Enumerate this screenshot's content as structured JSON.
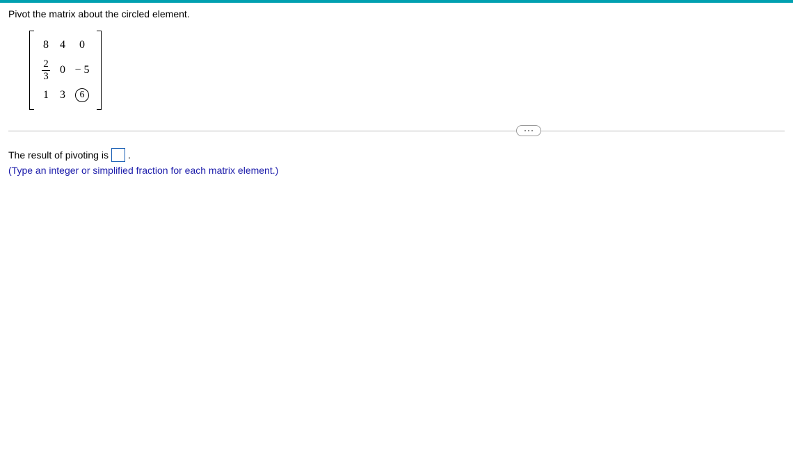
{
  "question": "Pivot the matrix about the circled element.",
  "matrix": {
    "r1c1": "8",
    "r1c2": "4",
    "r1c3": "0",
    "r2c1_num": "2",
    "r2c1_den": "3",
    "r2c2": "0",
    "r2c3": "− 5",
    "r3c1": "1",
    "r3c2": "3",
    "r3c3": "6"
  },
  "answer": {
    "prefix": "The result of pivoting is",
    "suffix": ".",
    "hint": "(Type an integer or simplified fraction for each matrix element.)"
  }
}
